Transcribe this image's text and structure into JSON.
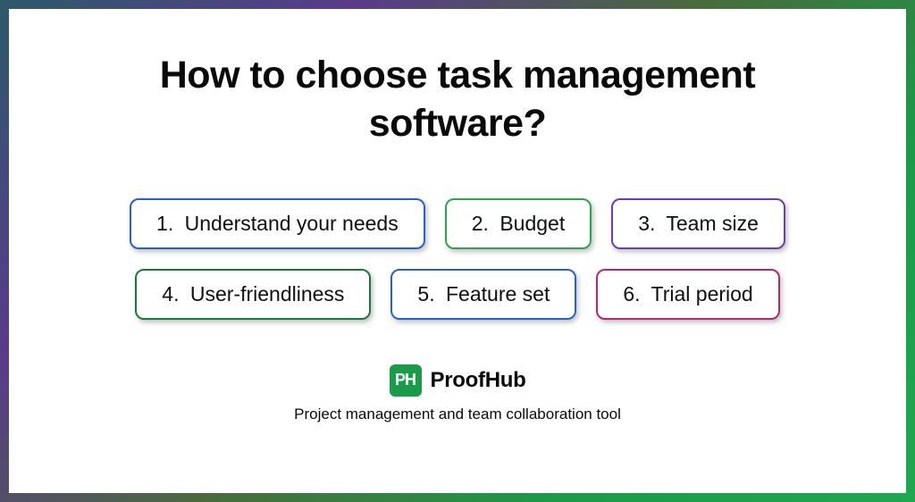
{
  "title": "How to choose task management software?",
  "items": [
    {
      "num": "1.",
      "label": "Understand your needs",
      "colorClass": "c-blue"
    },
    {
      "num": "2.",
      "label": "Budget",
      "colorClass": "c-green"
    },
    {
      "num": "3.",
      "label": "Team size",
      "colorClass": "c-purple"
    },
    {
      "num": "4.",
      "label": "User-friendliness",
      "colorClass": "c-dgreen"
    },
    {
      "num": "5.",
      "label": "Feature set",
      "colorClass": "c-blue2"
    },
    {
      "num": "6.",
      "label": "Trial period",
      "colorClass": "c-magenta"
    }
  ],
  "brand": {
    "logoText": "PH",
    "name": "ProofHub",
    "tagline": "Project management and team collaboration tool"
  }
}
